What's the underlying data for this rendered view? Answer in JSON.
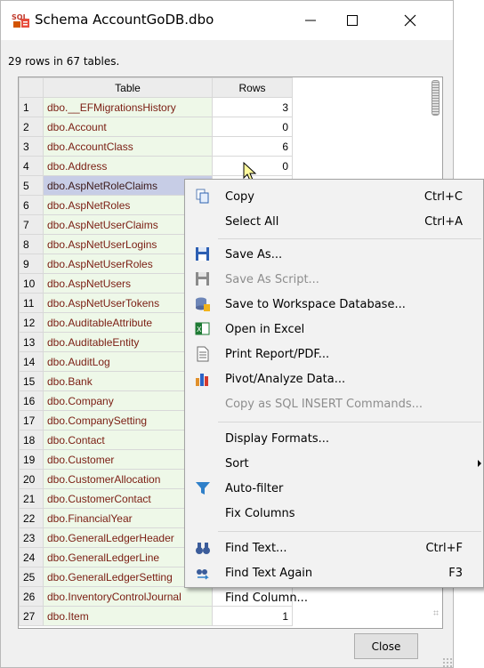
{
  "window": {
    "title": "Schema AccountGoDB.dbo",
    "minimize_glyph": "—",
    "maximize_glyph": "☐",
    "close_glyph": "✕",
    "icon": "sql-app-icon"
  },
  "summary": "29 rows in 67 tables.",
  "grid": {
    "headers": [
      "Table",
      "Rows"
    ],
    "rows": [
      {
        "n": "1",
        "table": "dbo.__EFMigrationsHistory",
        "rows": "3"
      },
      {
        "n": "2",
        "table": "dbo.Account",
        "rows": "0"
      },
      {
        "n": "3",
        "table": "dbo.AccountClass",
        "rows": "6"
      },
      {
        "n": "4",
        "table": "dbo.Address",
        "rows": "0"
      },
      {
        "n": "5",
        "table": "dbo.AspNetRoleClaims",
        "rows": ""
      },
      {
        "n": "6",
        "table": "dbo.AspNetRoles",
        "rows": ""
      },
      {
        "n": "7",
        "table": "dbo.AspNetUserClaims",
        "rows": ""
      },
      {
        "n": "8",
        "table": "dbo.AspNetUserLogins",
        "rows": ""
      },
      {
        "n": "9",
        "table": "dbo.AspNetUserRoles",
        "rows": ""
      },
      {
        "n": "10",
        "table": "dbo.AspNetUsers",
        "rows": ""
      },
      {
        "n": "11",
        "table": "dbo.AspNetUserTokens",
        "rows": ""
      },
      {
        "n": "12",
        "table": "dbo.AuditableAttribute",
        "rows": ""
      },
      {
        "n": "13",
        "table": "dbo.AuditableEntity",
        "rows": ""
      },
      {
        "n": "14",
        "table": "dbo.AuditLog",
        "rows": ""
      },
      {
        "n": "15",
        "table": "dbo.Bank",
        "rows": ""
      },
      {
        "n": "16",
        "table": "dbo.Company",
        "rows": ""
      },
      {
        "n": "17",
        "table": "dbo.CompanySetting",
        "rows": ""
      },
      {
        "n": "18",
        "table": "dbo.Contact",
        "rows": ""
      },
      {
        "n": "19",
        "table": "dbo.Customer",
        "rows": ""
      },
      {
        "n": "20",
        "table": "dbo.CustomerAllocation",
        "rows": ""
      },
      {
        "n": "21",
        "table": "dbo.CustomerContact",
        "rows": ""
      },
      {
        "n": "22",
        "table": "dbo.FinancialYear",
        "rows": ""
      },
      {
        "n": "23",
        "table": "dbo.GeneralLedgerHeader",
        "rows": ""
      },
      {
        "n": "24",
        "table": "dbo.GeneralLedgerLine",
        "rows": ""
      },
      {
        "n": "25",
        "table": "dbo.GeneralLedgerSetting",
        "rows": ""
      },
      {
        "n": "26",
        "table": "dbo.InventoryControlJournal",
        "rows": ""
      },
      {
        "n": "27",
        "table": "dbo.Item",
        "rows": "1"
      }
    ],
    "selected_row": "5"
  },
  "close_label": "Close",
  "context_menu": {
    "items": [
      {
        "label": "Copy",
        "shortcut": "Ctrl+C",
        "icon": "copy-icon",
        "disabled": false
      },
      {
        "label": "Select All",
        "shortcut": "Ctrl+A",
        "icon": "",
        "disabled": false
      },
      {
        "label": "Save As...",
        "shortcut": "",
        "icon": "floppy-disk-icon",
        "disabled": false
      },
      {
        "label": "Save As Script...",
        "shortcut": "",
        "icon": "save-script-icon",
        "disabled": true
      },
      {
        "label": "Save to Workspace Database...",
        "shortcut": "",
        "icon": "database-save-icon",
        "disabled": false
      },
      {
        "label": "Open in Excel",
        "shortcut": "",
        "icon": "excel-icon",
        "disabled": false
      },
      {
        "label": "Print Report/PDF...",
        "shortcut": "",
        "icon": "document-icon",
        "disabled": false
      },
      {
        "label": "Pivot/Analyze Data...",
        "shortcut": "",
        "icon": "bar-chart-icon",
        "disabled": false
      },
      {
        "label": "Copy as SQL INSERT Commands...",
        "shortcut": "",
        "icon": "",
        "disabled": true
      },
      {
        "label": "Display Formats...",
        "shortcut": "",
        "icon": "",
        "disabled": false
      },
      {
        "label": "Sort",
        "shortcut": "",
        "icon": "",
        "disabled": false,
        "submenu": true
      },
      {
        "label": "Auto-filter",
        "shortcut": "",
        "icon": "filter-funnel-icon",
        "disabled": false
      },
      {
        "label": "Fix Columns",
        "shortcut": "",
        "icon": "",
        "disabled": false
      },
      {
        "label": "Find Text...",
        "shortcut": "Ctrl+F",
        "icon": "binoculars-icon",
        "disabled": false
      },
      {
        "label": "Find Text Again",
        "shortcut": "F3",
        "icon": "find-again-icon",
        "disabled": false
      },
      {
        "label": "Find Column...",
        "shortcut": "",
        "icon": "",
        "disabled": false
      }
    ]
  },
  "colors": {
    "selected_row_bg": "#c7cde6",
    "table_cell_bg": "#eef8e8",
    "table_text": "#7a1d12",
    "disabled_text": "#8d8d8d"
  }
}
